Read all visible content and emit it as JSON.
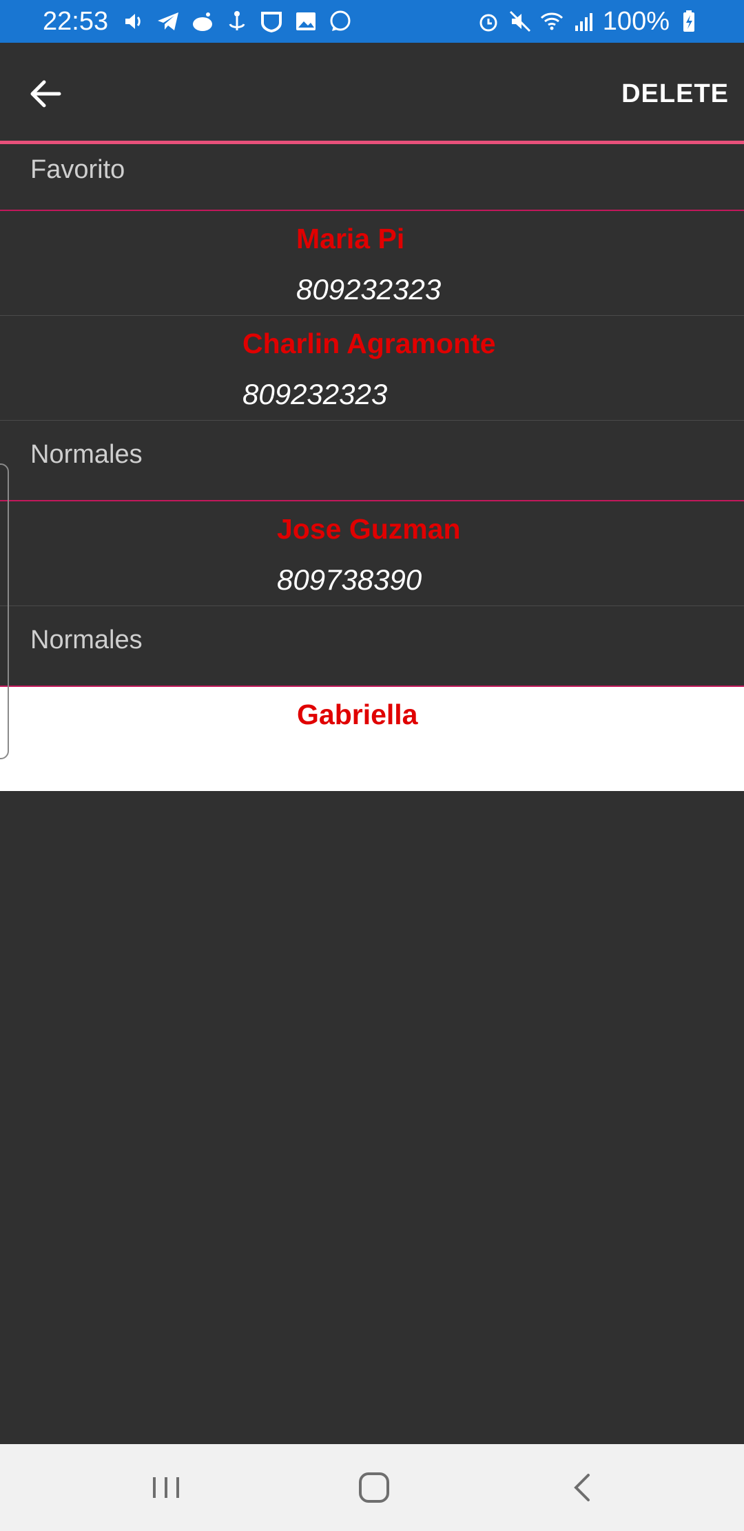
{
  "status_bar": {
    "time": "22:53",
    "battery": "100%",
    "left_icons": [
      "volume-icon",
      "telegram-icon",
      "reddit-icon",
      "anchor-icon",
      "shield-icon",
      "gallery-icon",
      "whatsapp-icon"
    ],
    "right_icons": [
      "alarm-icon",
      "mute-icon",
      "wifi-icon",
      "signal-icon",
      "battery-icon"
    ]
  },
  "app_bar": {
    "delete_label": "DELETE",
    "accent_color": "#e8507a"
  },
  "sections": [
    {
      "header": "Favorito",
      "contacts": [
        {
          "name": "Maria Pi",
          "phone": "809232323"
        },
        {
          "name": "Charlin Agramonte",
          "phone": "809232323"
        }
      ]
    },
    {
      "header": "Normales",
      "contacts": [
        {
          "name": "Jose Guzman",
          "phone": "809738390"
        }
      ]
    },
    {
      "header": "Normales",
      "contacts": [
        {
          "name": "Gabriella",
          "phone": ""
        }
      ]
    }
  ],
  "colors": {
    "background": "#303030",
    "name": "#e00000",
    "phone": "#ffffff",
    "status_bar": "#1976d2"
  }
}
